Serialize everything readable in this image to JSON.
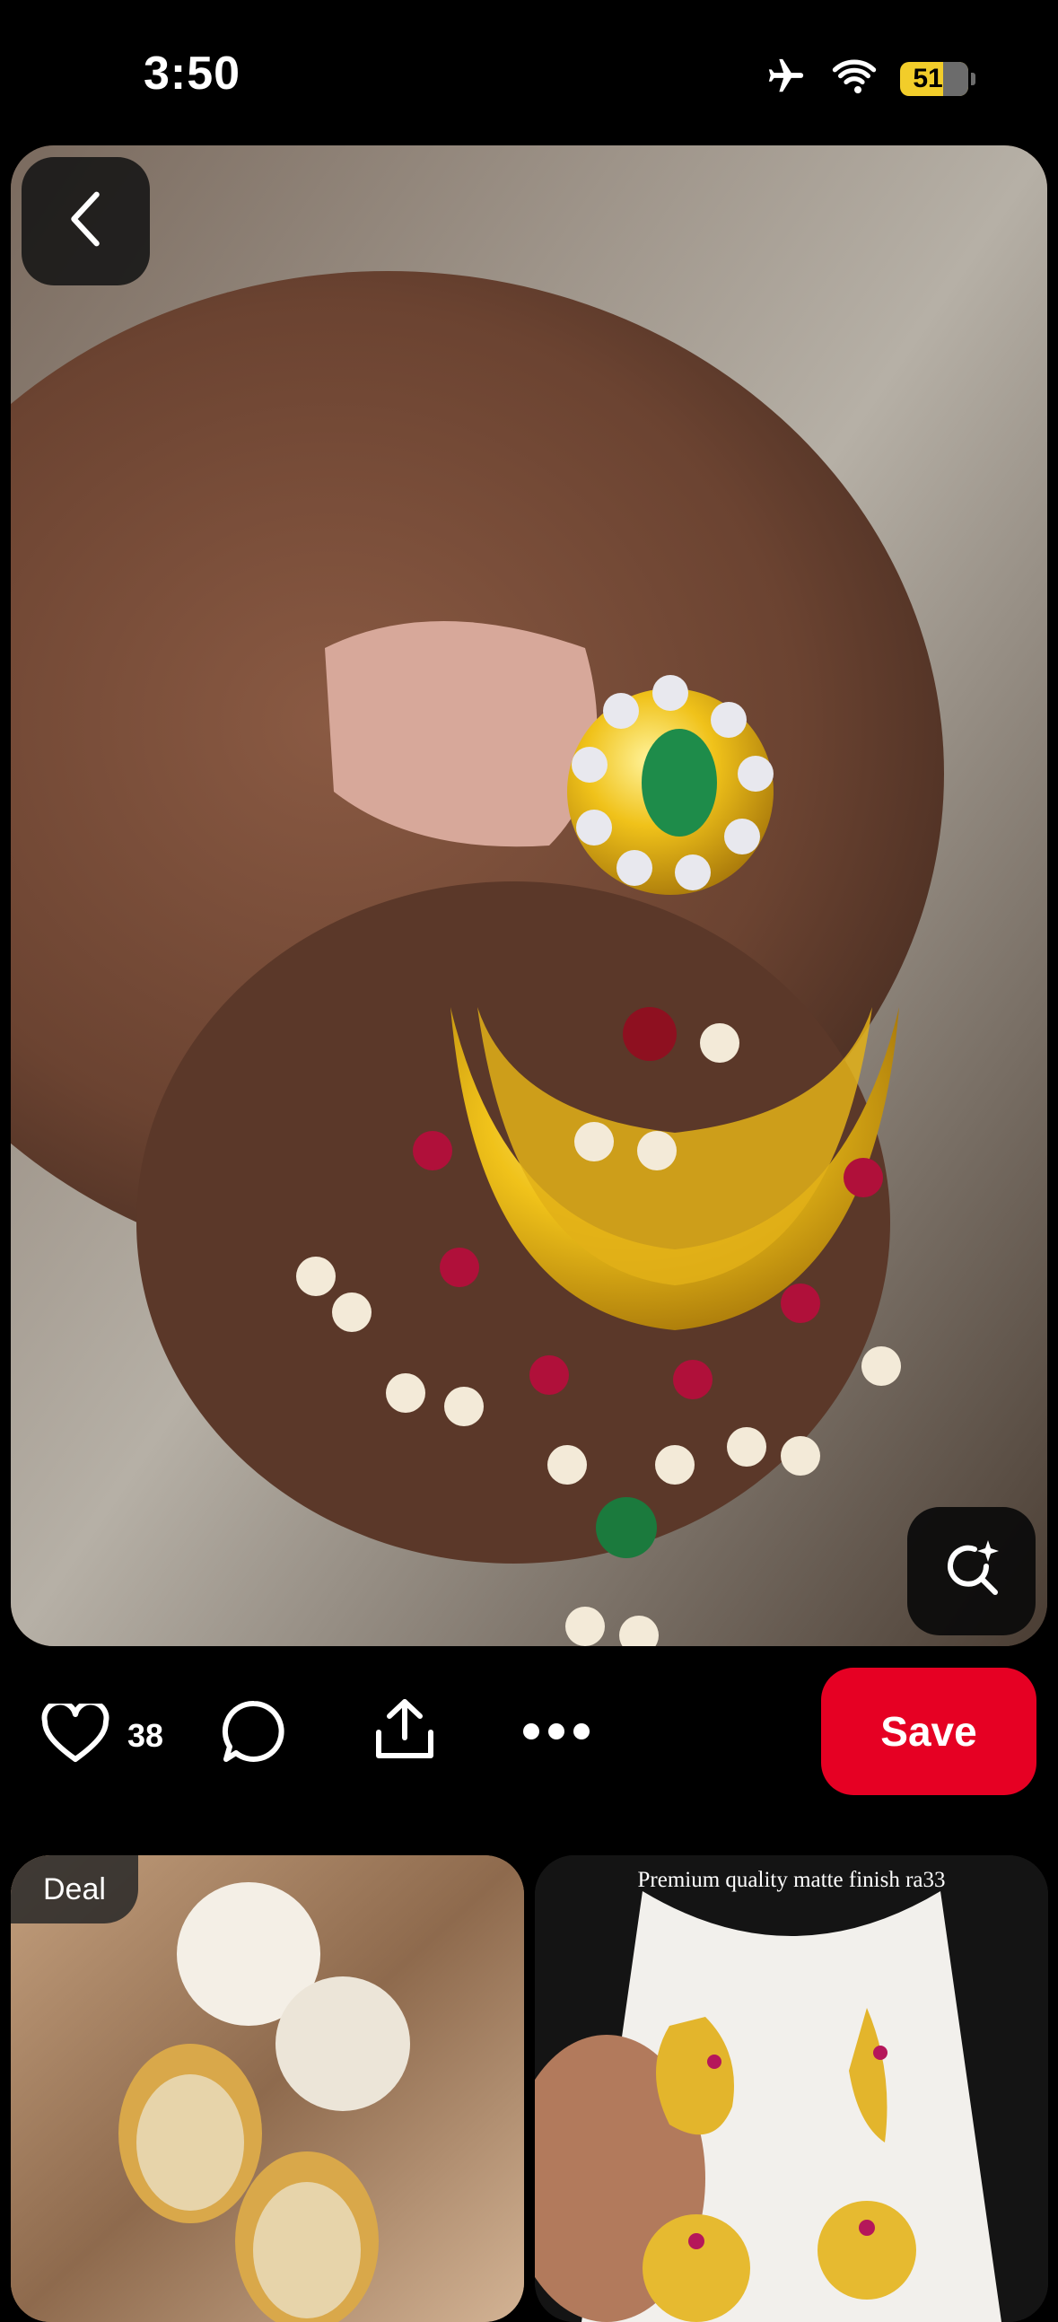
{
  "status_bar": {
    "time": "3:50",
    "battery": "51"
  },
  "pin": {
    "image_alt": "Gold chandbali earring with green and red stones held between fingers",
    "likes": "38"
  },
  "actions": {
    "save_label": "Save"
  },
  "related": [
    {
      "badge": "Deal",
      "image_alt": "Pearl drop jhumka earrings with stone studs"
    },
    {
      "caption": "Premium quality matte finish ra33",
      "image_alt": "Peacock jhumka earrings on display stand"
    }
  ],
  "colors": {
    "accent": "#e60023",
    "background": "#000000",
    "battery": "#f2cd2a"
  },
  "icons": [
    "chevron-left-icon",
    "visual-search-icon",
    "heart-icon",
    "comment-icon",
    "share-icon",
    "more-icon",
    "airplane-icon",
    "wifi-icon",
    "battery-icon"
  ]
}
